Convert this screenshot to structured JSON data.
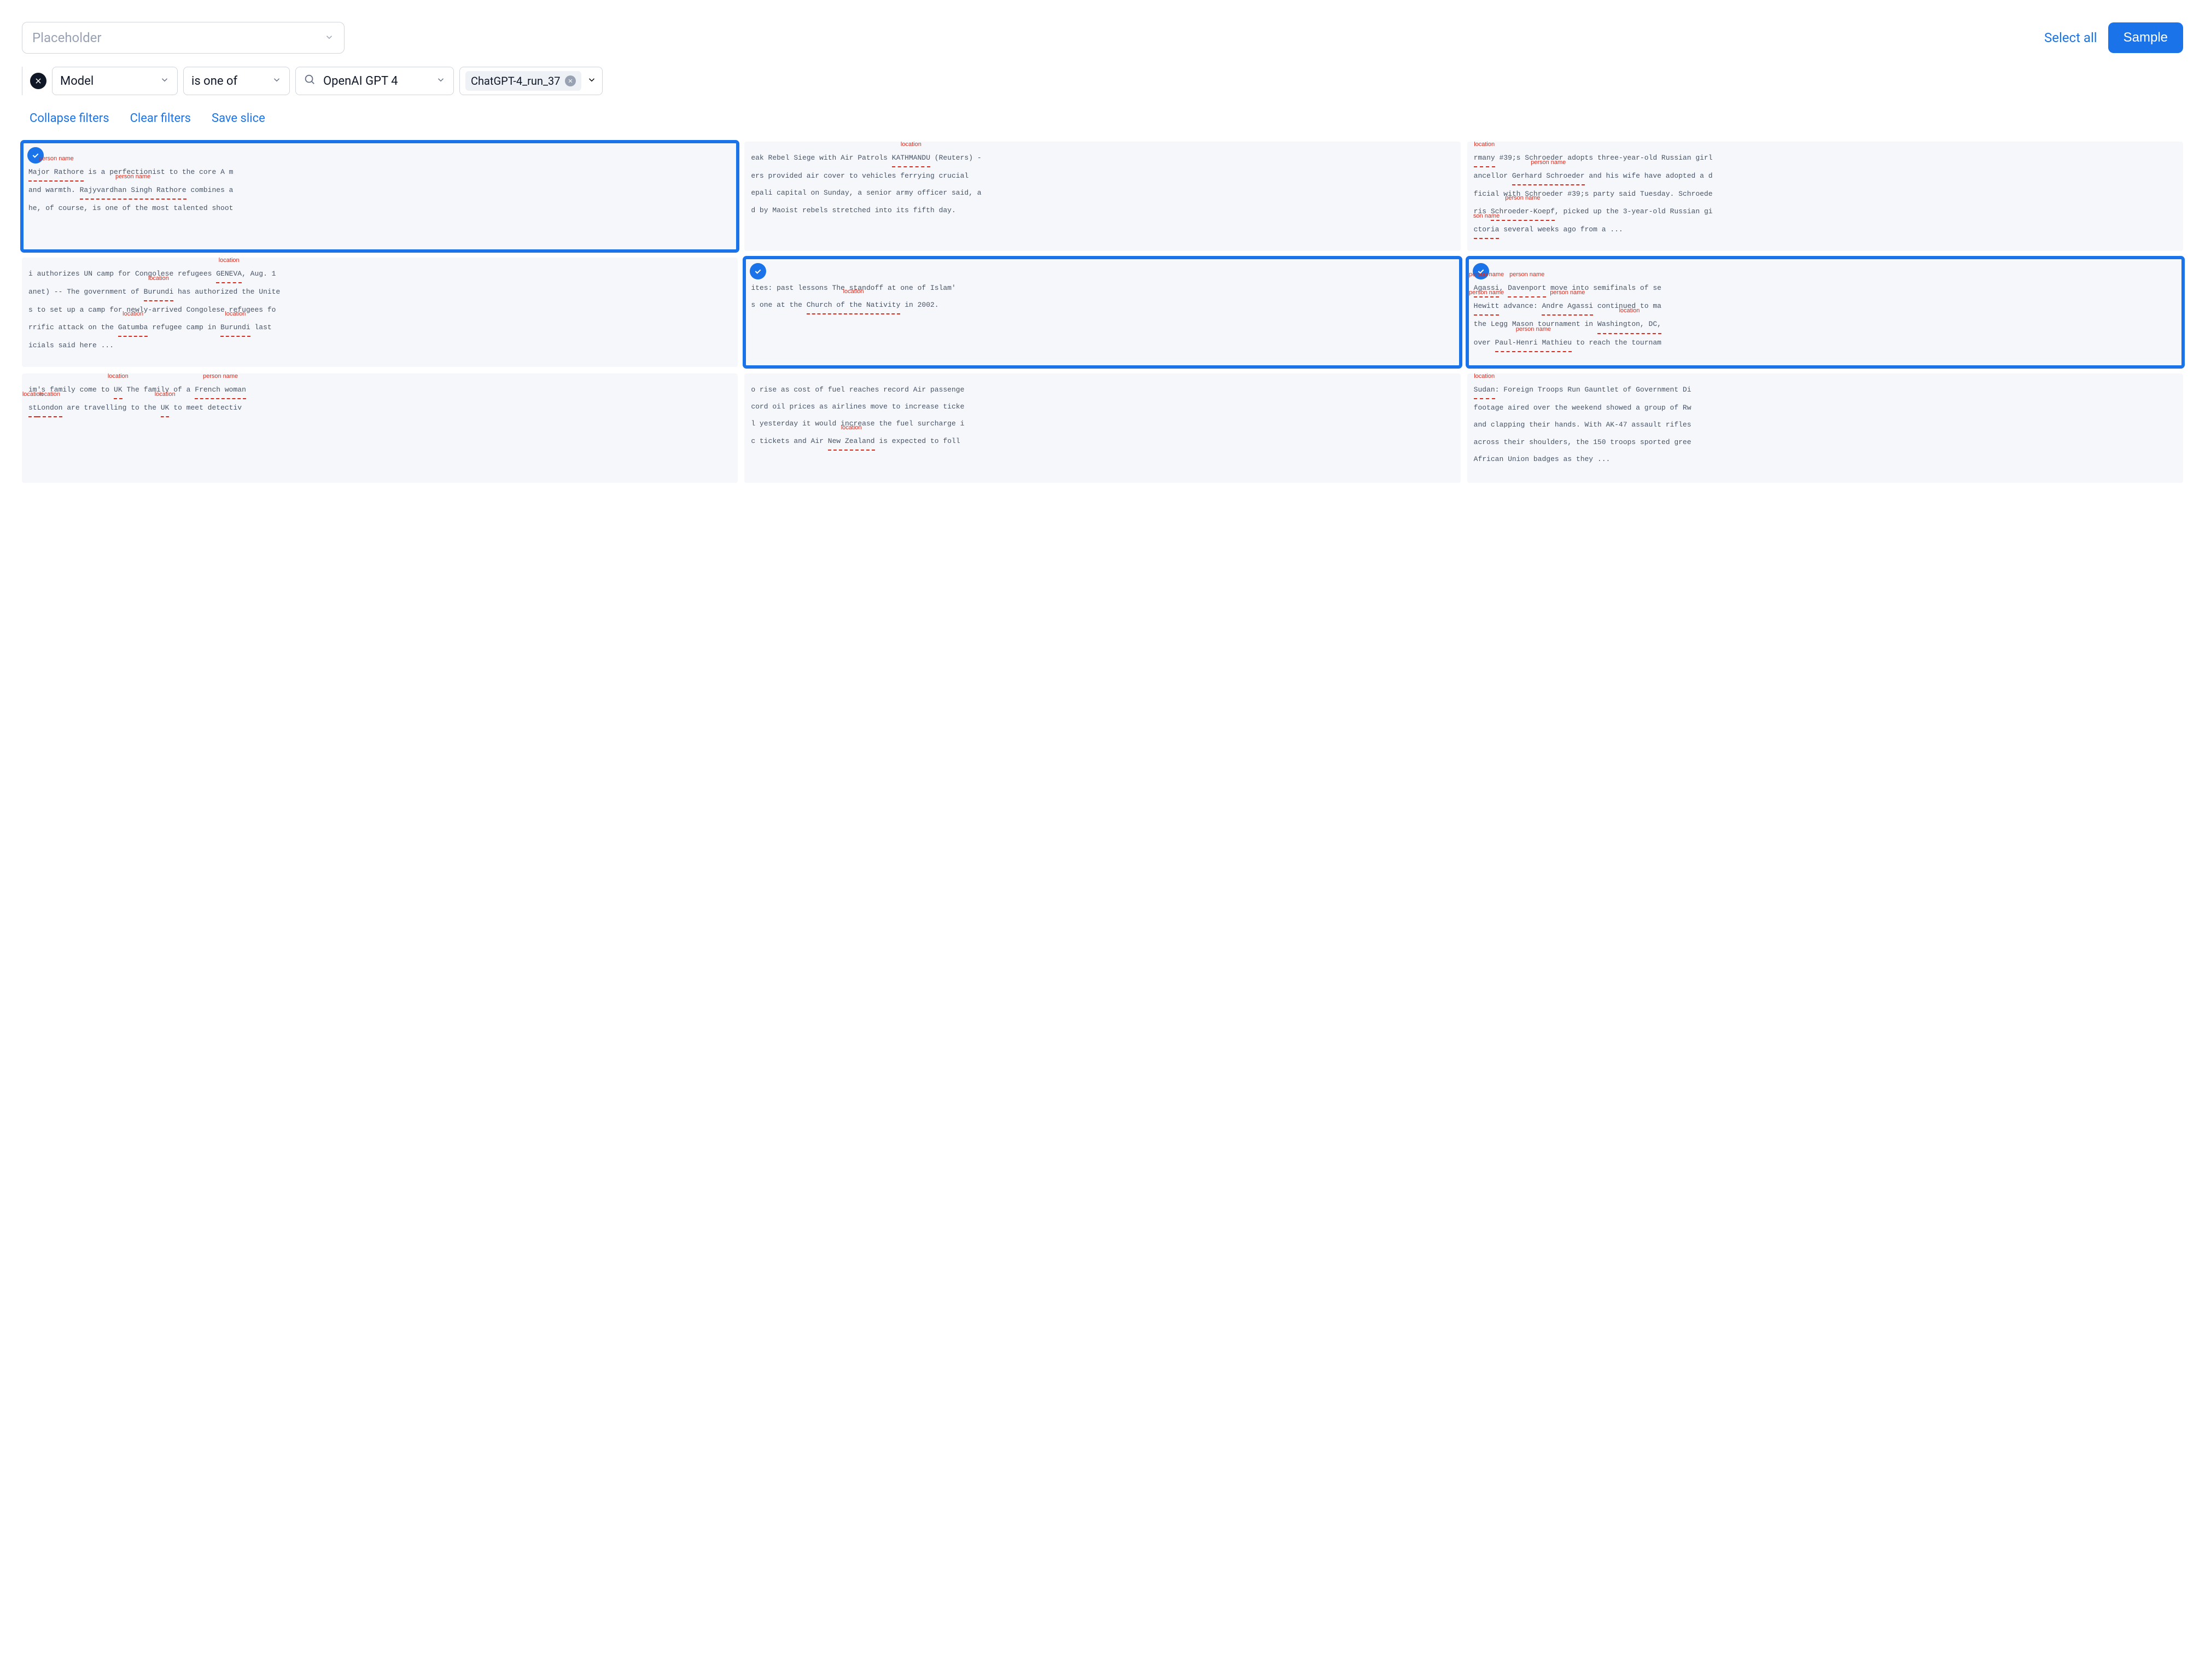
{
  "topbar": {
    "placeholder": "Placeholder",
    "select_all": "Select all",
    "sample": "Sample"
  },
  "filter": {
    "field": "Model",
    "operator": "is one of",
    "search_value": "OpenAI GPT 4",
    "chip": "ChatGPT-4_run_37"
  },
  "actions": {
    "collapse": "Collapse filters",
    "clear": "Clear filters",
    "save": "Save slice"
  },
  "labels": {
    "person": "person name",
    "location": "location",
    "son_name": "son name"
  },
  "cards": [
    {
      "selected": true,
      "lines": [
        [
          {
            "t": "Major Rathore",
            "a": "person"
          },
          {
            "t": " is a perfectionist to the core A m"
          }
        ],
        [
          {
            "t": "and warmth. "
          },
          {
            "t": "Rajyvardhan Singh Rathore",
            "a": "person"
          },
          {
            "t": " combines a"
          }
        ],
        [
          {
            "t": "he, of course, is one of the most talented shoot"
          }
        ]
      ]
    },
    {
      "selected": false,
      "lines": [
        [
          {
            "t": "eak Rebel Siege with Air Patrols  "
          },
          {
            "t": "KATHMANDU",
            "a": "location"
          },
          {
            "t": " (Reuters) -"
          }
        ],
        [
          {
            "t": "ers provided air  cover to vehicles ferrying crucial"
          }
        ],
        [
          {
            "t": "epali  capital on Sunday, a senior army officer said, a"
          }
        ],
        [
          {
            "t": "d by Maoist rebels stretched into its fifth day."
          }
        ]
      ]
    },
    {
      "selected": false,
      "lines": [
        [
          {
            "t": "rmany",
            "a": "location"
          },
          {
            "t": " #39;s Schroeder adopts three-year-old Russian girl"
          }
        ],
        [
          {
            "t": "ancellor "
          },
          {
            "t": "Gerhard Schroeder",
            "a": "person"
          },
          {
            "t": " and his wife have adopted a d"
          }
        ],
        [
          {
            "t": "ficial with Schroeder #39;s party said Tuesday. Schroede"
          }
        ],
        [
          {
            "t": "ris "
          },
          {
            "t": "Schroeder-Koepf",
            "a": "person"
          },
          {
            "t": ", picked up the 3-year-old Russian gi"
          }
        ],
        [
          {
            "t": "ctoria",
            "a": "son_name"
          },
          {
            "t": " several weeks ago from a ..."
          }
        ]
      ]
    },
    {
      "selected": false,
      "lines": [
        [
          {
            "t": "i authorizes UN camp for Congolese refugees "
          },
          {
            "t": "GENEVA",
            "a": "location"
          },
          {
            "t": ", Aug. 1"
          }
        ],
        [
          {
            "t": "anet) -- The government of "
          },
          {
            "t": "Burundi",
            "a": "location"
          },
          {
            "t": " has authorized the Unite"
          }
        ],
        [
          {
            "t": "s to set up a camp for newly-arrived Congolese refugees fo"
          }
        ],
        [
          {
            "t": "rrific attack on the "
          },
          {
            "t": "Gatumba",
            "a": "location"
          },
          {
            "t": " refugee camp in "
          },
          {
            "t": "Burundi",
            "a": "location"
          },
          {
            "t": " last "
          }
        ],
        [
          {
            "t": "icials said here ..."
          }
        ]
      ]
    },
    {
      "selected": true,
      "lines": [
        [
          {
            "t": "ites: past lessons The standoff at one of Islam'"
          }
        ],
        [
          {
            "t": "s one at the "
          },
          {
            "t": "Church of the Nativity",
            "a": "location"
          },
          {
            "t": " in 2002."
          }
        ]
      ]
    },
    {
      "selected": true,
      "lines": [
        [
          {
            "t": "Agassi",
            "a": "person"
          },
          {
            "t": ", "
          },
          {
            "t": "Davenport",
            "a": "person"
          },
          {
            "t": " move into semifinals of se"
          }
        ],
        [
          {
            "t": "Hewitt",
            "a": "person"
          },
          {
            "t": " advance: "
          },
          {
            "t": "Andre Agassi",
            "a": "person"
          },
          {
            "t": " continued to ma"
          }
        ],
        [
          {
            "t": " the Legg Mason tournament in "
          },
          {
            "t": "Washington, DC,",
            "a": "location"
          }
        ],
        [
          {
            "t": " over "
          },
          {
            "t": "Paul-Henri Mathieu",
            "a": "person"
          },
          {
            "t": " to reach the tournam"
          }
        ]
      ]
    },
    {
      "selected": false,
      "lines": [
        [
          {
            "t": " "
          }
        ],
        [
          {
            "t": "im's family come to "
          },
          {
            "t": "UK",
            "a": "location"
          },
          {
            "t": " The family of a "
          },
          {
            "t": "French woman",
            "a": "person"
          }
        ],
        [
          {
            "t": "st ",
            "a": "location"
          },
          {
            "t": "London",
            "a": "location"
          },
          {
            "t": " are travelling to the "
          },
          {
            "t": "UK",
            "a": "location"
          },
          {
            "t": " to meet detectiv"
          }
        ]
      ]
    },
    {
      "selected": false,
      "lines": [
        [
          {
            "t": "o rise as cost of fuel reaches record Air passenge"
          }
        ],
        [
          {
            "t": "cord oil prices as airlines move to increase ticke"
          }
        ],
        [
          {
            "t": "l yesterday it would increase the fuel surcharge i"
          }
        ],
        [
          {
            "t": "c tickets and Air "
          },
          {
            "t": "New Zealand",
            "a": "location"
          },
          {
            "t": " is expected to foll"
          }
        ]
      ]
    },
    {
      "selected": false,
      "lines": [
        [
          {
            "t": "Sudan",
            "a": "location"
          },
          {
            "t": ": Foreign Troops Run Gauntlet of Government Di"
          }
        ],
        [
          {
            "t": " footage aired over the weekend showed a group of Rw"
          }
        ],
        [
          {
            "t": " and clapping their hands. With AK-47 assault rifles"
          }
        ],
        [
          {
            "t": " across their shoulders, the 150 troops sported gree"
          }
        ],
        [
          {
            "t": " African Union badges as they ..."
          }
        ]
      ]
    }
  ]
}
